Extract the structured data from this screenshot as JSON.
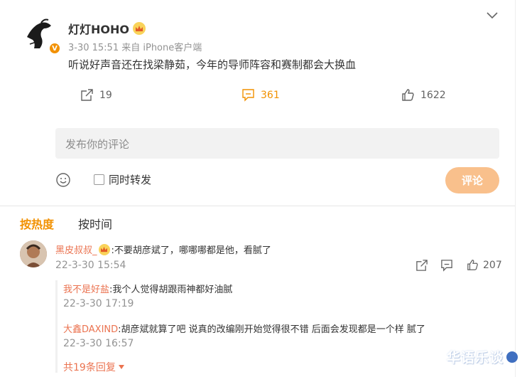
{
  "post": {
    "username": "灯灯HOHO",
    "verified_badge": "V",
    "meta": "3-30 15:51  来自 iPhone客户端",
    "text": "听说好声音还在找梁静茹，今年的导师阵容和赛制都会大换血",
    "actions": {
      "repost_count": "19",
      "comment_count": "361",
      "like_count": "1622"
    },
    "menu_icon": "chevron-down-icon"
  },
  "comment_input": {
    "placeholder": "发布你的评论",
    "repost_label": "同时转发",
    "submit_label": "评论"
  },
  "sort": {
    "hot": "按热度",
    "time": "按时间"
  },
  "comments": [
    {
      "user": "黑皮叔叔_",
      "text": ":不要胡彦斌了，哪哪哪都是他，看腻了",
      "date": "22-3-30 15:54",
      "like_count": "207",
      "replies": [
        {
          "user": "我不是好盐",
          "text": ":我个人觉得胡跟雨神都好油腻",
          "date": "22-3-30 17:19"
        },
        {
          "user": "大鑫DAXIND",
          "text": ":胡彦斌就算了吧  说真的改编刚开始觉得很不错  后面会发现都是一个样 腻了",
          "date": "22-3-30 16:57"
        }
      ],
      "more_replies": "共19条回复"
    }
  ],
  "watermark": "华语乐谈",
  "colors": {
    "accent": "#f29100",
    "username_link": "#eb7350",
    "submit_bg": "#f9c08c"
  }
}
